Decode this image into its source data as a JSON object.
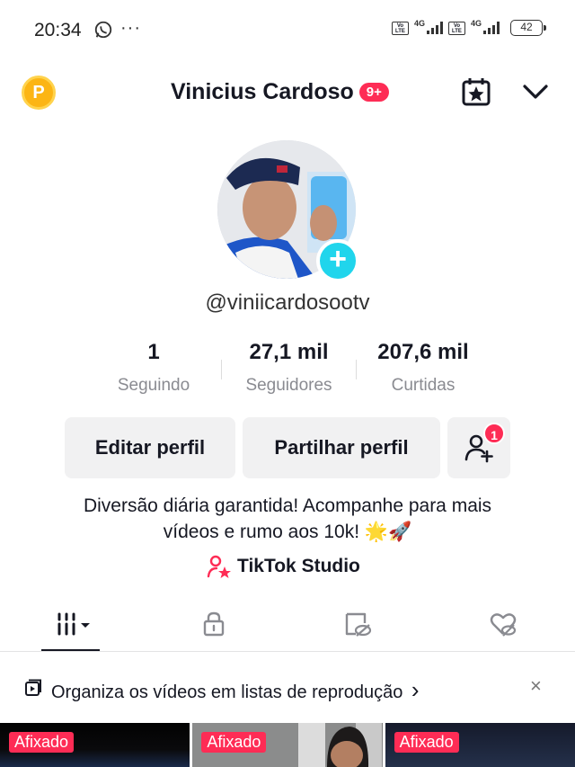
{
  "status_bar": {
    "time": "20:34",
    "dots": "···",
    "network_1": "4G",
    "network_2": "4G",
    "volte_label": "Vo LTE",
    "battery": "42"
  },
  "header": {
    "coin_letter": "P",
    "username": "Vinicius Cardoso",
    "notification_badge": "9+",
    "icons": [
      "coin-icon",
      "calendar-star-icon",
      "chevron-down-icon"
    ]
  },
  "profile": {
    "handle": "@viniicardosootv",
    "add_icon": "+"
  },
  "stats": [
    {
      "value": "1",
      "label": "Seguindo"
    },
    {
      "value": "27,1 mil",
      "label": "Seguidores"
    },
    {
      "value": "207,6 mil",
      "label": "Curtidas"
    }
  ],
  "buttons": {
    "edit": "Editar perfil",
    "share": "Partilhar perfil",
    "friends_badge": "1"
  },
  "bio": {
    "line1": "Diversão diária garantida! Acompanhe para mais",
    "line2": "vídeos e rumo aos 10k! 🌟🚀"
  },
  "studio_link": "TikTok Studio",
  "tabs": [
    "videos-grid-tab",
    "private-lock-tab",
    "reposts-tab",
    "liked-tab"
  ],
  "banner": {
    "text": "Organiza os vídeos em listas de reprodução",
    "arrow": "›",
    "close": "×"
  },
  "grid": {
    "pinned_label": "Afixado"
  },
  "colors": {
    "accent": "#fe2c55",
    "avatar_add": "#20d5ec",
    "coin": "#fcb514"
  }
}
